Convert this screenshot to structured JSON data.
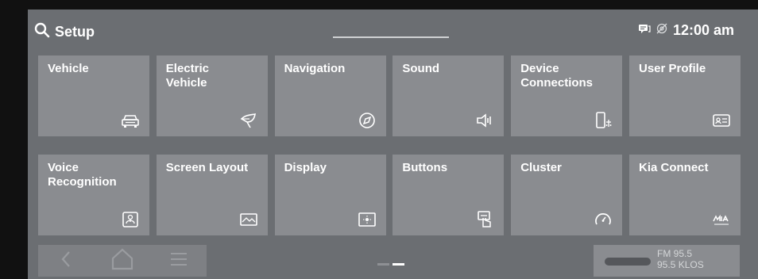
{
  "header": {
    "title": "Setup",
    "search_icon": "search-icon",
    "status_icons": [
      "message-icon",
      "location-off-icon"
    ],
    "clock": "12:00 am"
  },
  "tiles": [
    {
      "label": "Vehicle",
      "icon": "car-icon"
    },
    {
      "label": "Electric\nVehicle",
      "icon": "leaf-plug-icon"
    },
    {
      "label": "Navigation",
      "icon": "compass-icon"
    },
    {
      "label": "Sound",
      "icon": "speaker-icon"
    },
    {
      "label": "Device\nConnections",
      "icon": "phone-connect-icon"
    },
    {
      "label": "User Profile",
      "icon": "profile-card-icon"
    },
    {
      "label": "Voice\nRecognition",
      "icon": "voice-icon"
    },
    {
      "label": "Screen Layout",
      "icon": "layout-icon"
    },
    {
      "label": "Display",
      "icon": "display-brightness-icon"
    },
    {
      "label": "Buttons",
      "icon": "button-press-icon"
    },
    {
      "label": "Cluster",
      "icon": "gauge-icon"
    },
    {
      "label": "Kia Connect",
      "icon": "kia-connect-icon"
    }
  ],
  "navbar": {
    "back_icon": "back-icon",
    "home_icon": "home-icon",
    "menu_icon": "menu-icon"
  },
  "pager": {
    "pages": 2,
    "active": 2
  },
  "media": {
    "line1": "FM 95.5",
    "line2": "95.5 KLOS"
  },
  "colors": {
    "background": "#6b6e72",
    "tile": "#8a8c90",
    "text": "#ffffff"
  }
}
